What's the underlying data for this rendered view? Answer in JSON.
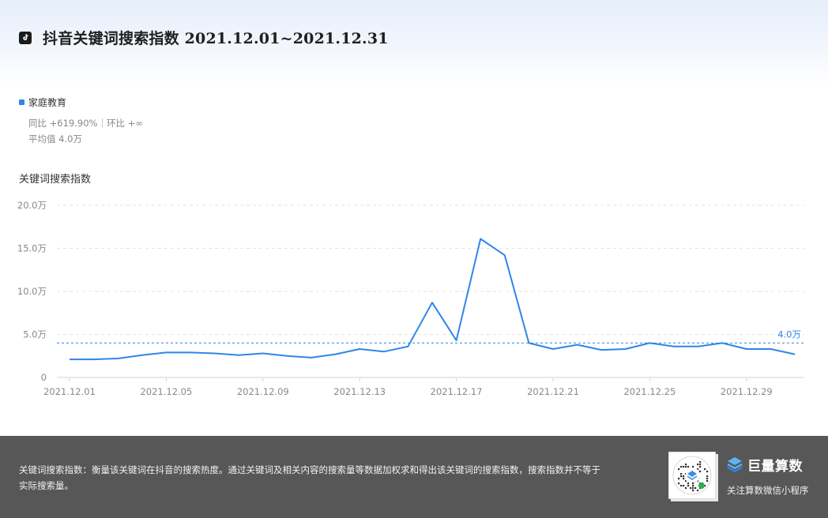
{
  "header": {
    "title": "抖音关键词搜索指数 2021.12.01~2021.12.31",
    "icon": "tiktok-icon"
  },
  "legend": {
    "series_name": "家庭教育",
    "color": "#2e86e8",
    "yoy_text": "同比 +619.90%｜环比 +∞",
    "average_text": "平均值 4.0万"
  },
  "chart_label": "关键词搜索指数",
  "chart_data": {
    "type": "line",
    "x": [
      "2021.12.01",
      "2021.12.02",
      "2021.12.03",
      "2021.12.04",
      "2021.12.05",
      "2021.12.06",
      "2021.12.07",
      "2021.12.08",
      "2021.12.09",
      "2021.12.10",
      "2021.12.11",
      "2021.12.12",
      "2021.12.13",
      "2021.12.14",
      "2021.12.15",
      "2021.12.16",
      "2021.12.17",
      "2021.12.18",
      "2021.12.19",
      "2021.12.20",
      "2021.12.21",
      "2021.12.22",
      "2021.12.23",
      "2021.12.24",
      "2021.12.25",
      "2021.12.26",
      "2021.12.27",
      "2021.12.28",
      "2021.12.29",
      "2021.12.30",
      "2021.12.31"
    ],
    "x_tick_labels": [
      "2021.12.01",
      "2021.12.05",
      "2021.12.09",
      "2021.12.13",
      "2021.12.17",
      "2021.12.21",
      "2021.12.25",
      "2021.12.29"
    ],
    "series": [
      {
        "name": "家庭教育",
        "values": [
          2.1,
          2.1,
          2.2,
          2.6,
          2.9,
          2.9,
          2.8,
          2.6,
          2.8,
          2.5,
          2.3,
          2.7,
          3.3,
          3.0,
          3.6,
          8.7,
          4.3,
          16.1,
          14.2,
          4.0,
          3.3,
          3.8,
          3.2,
          3.3,
          4.0,
          3.6,
          3.6,
          4.0,
          3.3,
          3.3,
          2.7
        ]
      }
    ],
    "y_ticks": [
      0,
      5,
      10,
      15,
      20
    ],
    "y_tick_labels": [
      "0",
      "5.0万",
      "10.0万",
      "15.0万",
      "20.0万"
    ],
    "ylim": [
      0,
      20
    ],
    "average": 4.0,
    "average_label": "4.0万",
    "grid": "dashed-horizontal",
    "line_color": "#2e86e8"
  },
  "footer": {
    "description": "关键词搜索指数：衡量该关键词在抖音的搜索热度。通过关键词及相关内容的搜索量等数据加权求和得出该关键词的搜索指数，搜索指数并不等于实际搜索量。",
    "brand_name": "巨量算数",
    "brand_sub": "关注算数微信小程序",
    "qr_icon": "qr-code-icon",
    "brand_icon": "brand-logo-icon"
  }
}
